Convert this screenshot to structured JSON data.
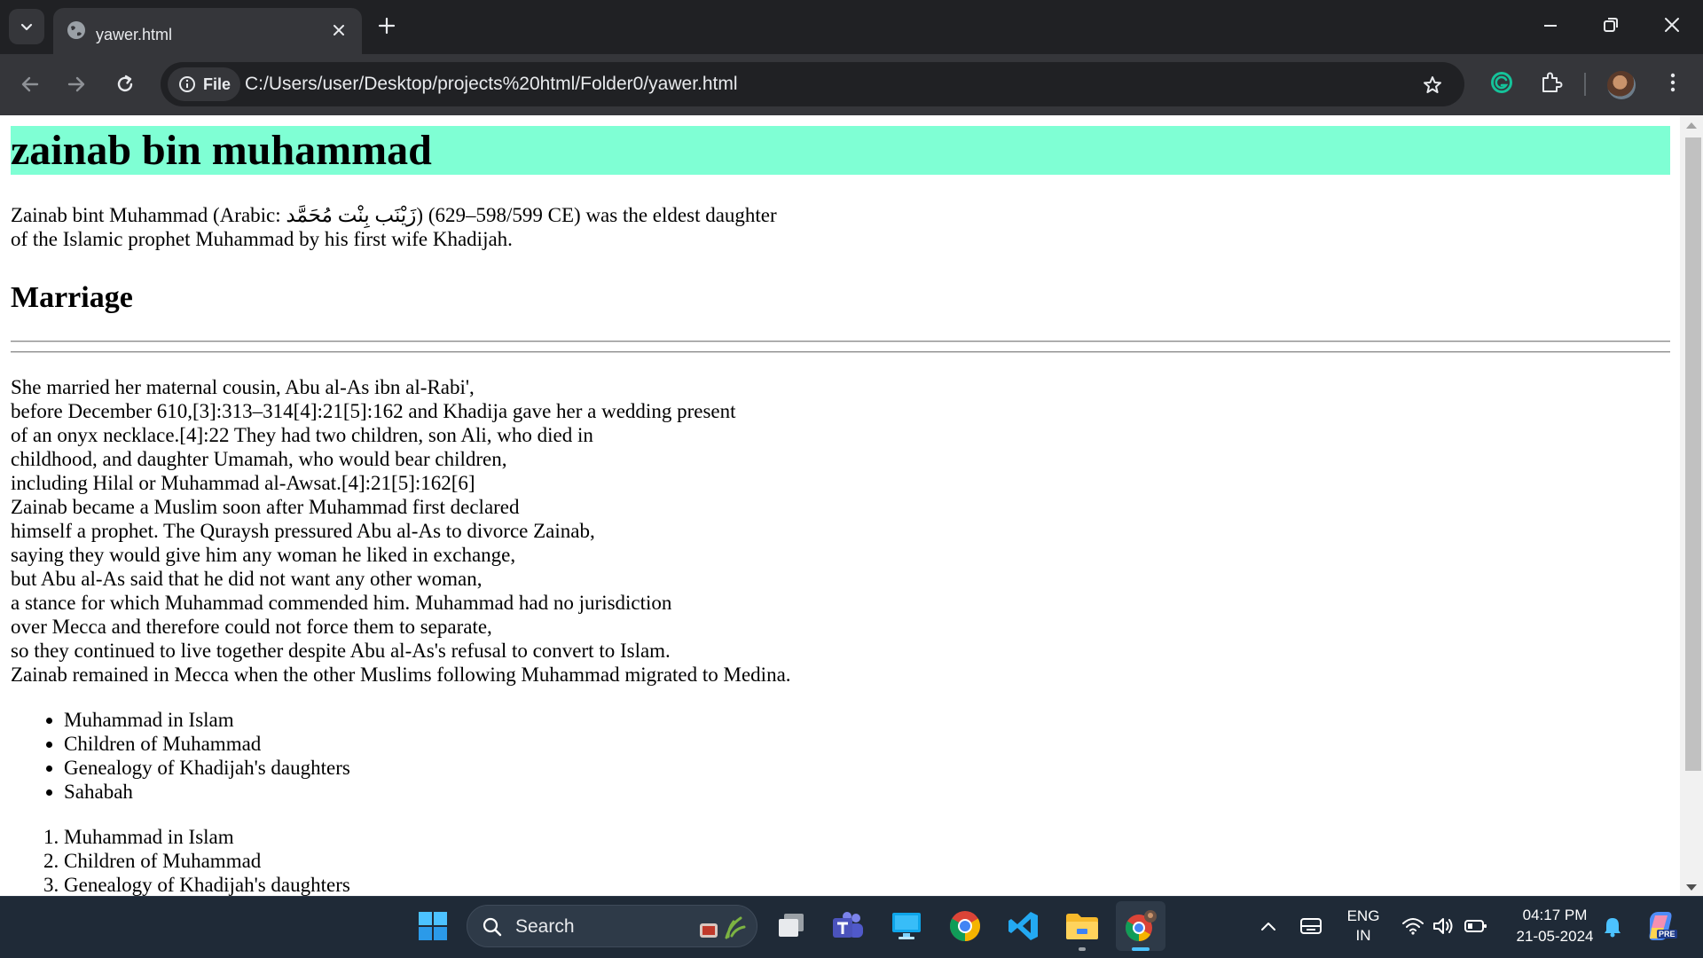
{
  "browser": {
    "tab_title": "yawer.html",
    "chip_label": "File",
    "url": "C:/Users/user/Desktop/projects%20html/Folder0/yawer.html",
    "colors": {
      "frame": "#202124",
      "toolbar": "#35363a",
      "text": "#e8eaed"
    }
  },
  "page": {
    "title": "zainab bin muhammad",
    "title_bg": "#7fffd4",
    "intro_line1": "Zainab bint Muhammad (Arabic: زَيْنَب بِنْت مُحَمَّد) (598/599–629 CE) was the eldest daughter",
    "intro_line2": "of the Islamic prophet Muhammad by his first wife Khadijah.",
    "section_heading": "Marriage",
    "body_lines": [
      "She married her maternal cousin, Abu al-As ibn al-Rabi',",
      "before December 610,[3]:313–314[4]:21[5]:162 and Khadija gave her a wedding present",
      "of an onyx necklace.[4]:22 They had two children, son Ali, who died in",
      "childhood, and daughter Umamah, who would bear children,",
      "including Hilal or Muhammad al-Awsat.[4]:21[5]:162[6]",
      "Zainab became a Muslim soon after Muhammad first declared",
      "himself a prophet. The Quraysh pressured Abu al-As to divorce Zainab,",
      "saying they would give him any woman he liked in exchange,",
      "but Abu al-As said that he did not want any other woman,",
      "a stance for which Muhammad commended him. Muhammad had no jurisdiction",
      "over Mecca and therefore could not force them to separate,",
      "so they continued to live together despite Abu al-As's refusal to convert to Islam.",
      "Zainab remained in Mecca when the other Muslims following Muhammad migrated to Medina."
    ],
    "unordered_list": [
      "Muhammad in Islam",
      "Children of Muhammad",
      "Genealogy of Khadijah's daughters",
      "Sahabah"
    ],
    "ordered_list": [
      "Muhammad in Islam",
      "Children of Muhammad",
      "Genealogy of Khadijah's daughters"
    ]
  },
  "taskbar": {
    "search_label": "Search",
    "lang_line1": "ENG",
    "lang_line2": "IN",
    "time": "04:17 PM",
    "date": "21-05-2024",
    "copilot_badge": "PRE"
  }
}
